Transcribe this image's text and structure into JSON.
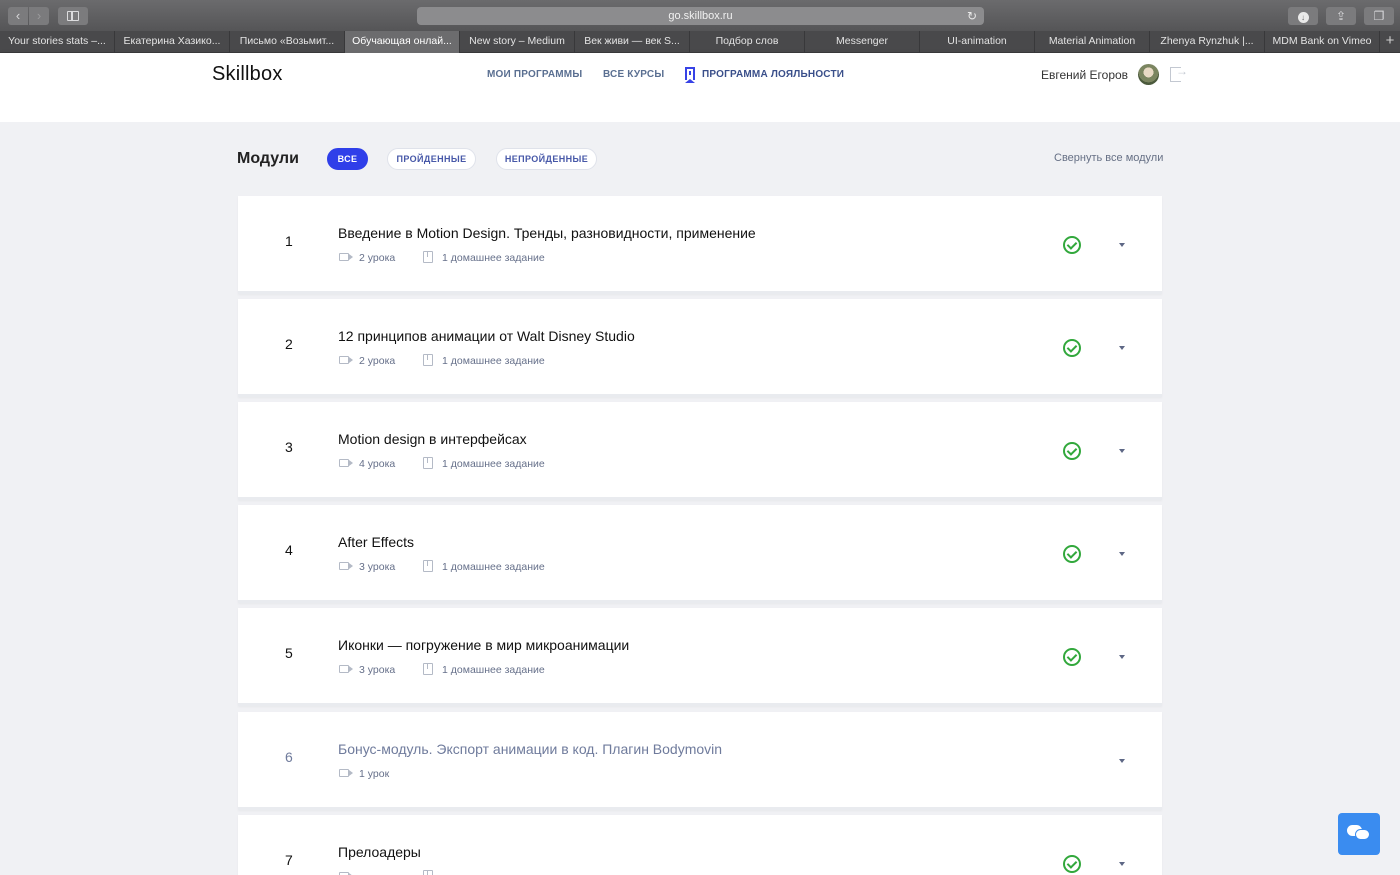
{
  "browser": {
    "url": "go.skillbox.ru",
    "tabs": [
      "Your stories stats –...",
      "Екатерина Хазико...",
      "Письмо «Возьмит...",
      "Обучающая онлай...",
      "New story – Medium",
      "Век живи — век S...",
      "Подбор слов",
      "Messenger",
      "UI-animation",
      "Material Animation",
      "Zhenya Rynzhuk |...",
      "MDM Bank on Vimeo"
    ],
    "active_tab_index": 3
  },
  "header": {
    "logo": "Skillbox",
    "nav": [
      "МОИ ПРОГРАММЫ",
      "ВСЕ КУРСЫ",
      "ПРОГРАММА ЛОЯЛЬНОСТИ"
    ],
    "username": "Евгений Егоров"
  },
  "modules_section": {
    "title": "Модули",
    "filters": [
      "ВСЕ",
      "ПРОЙДЕННЫЕ",
      "НЕПРОЙДЕННЫЕ"
    ],
    "active_filter": "ВСЕ",
    "collapse_all": "Свернуть все модули"
  },
  "modules": [
    {
      "number": "1",
      "title": "Введение в Motion Design. Тренды, разновидности, применение",
      "lessons": "2 урока",
      "homework": "1 домашнее задание",
      "completed": true
    },
    {
      "number": "2",
      "title": "12 принципов анимации от Walt Disney Studio",
      "lessons": "2 урока",
      "homework": "1 домашнее задание",
      "completed": true
    },
    {
      "number": "3",
      "title": "Motion design в интерфейсах",
      "lessons": "4 урока",
      "homework": "1 домашнее задание",
      "completed": true
    },
    {
      "number": "4",
      "title": "After Effects",
      "lessons": "3 урока",
      "homework": "1 домашнее задание",
      "completed": true
    },
    {
      "number": "5",
      "title": "Иконки — погружение в мир микроанимации",
      "lessons": "3 урока",
      "homework": "1 домашнее задание",
      "completed": true
    },
    {
      "number": "6",
      "title": "Бонус-модуль. Экспорт анимации в код. Плагин Bodymovin",
      "lessons": "1 урок",
      "homework": "",
      "completed": false
    },
    {
      "number": "7",
      "title": "Прелоадеры",
      "lessons": "",
      "homework": "",
      "completed": true
    }
  ],
  "colors": {
    "accent": "#2f3fe9",
    "success": "#32a83c",
    "chat": "#3a8cf0"
  }
}
